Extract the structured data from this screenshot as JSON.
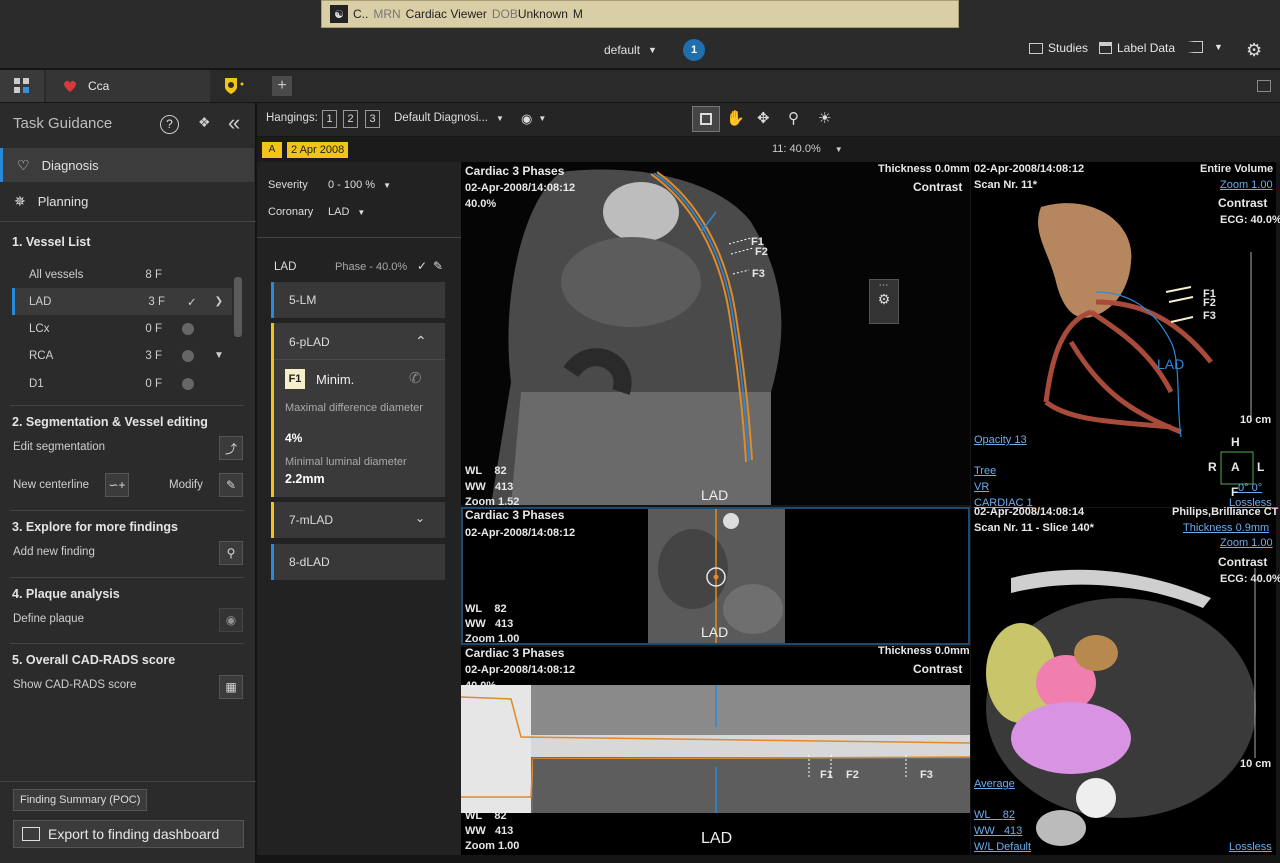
{
  "patient_bar": {
    "name": "C..",
    "mrn_label": "MRN",
    "app": "Cardiac Viewer",
    "dob_label": "DOB",
    "dob": "Unknown",
    "sex": "M"
  },
  "header": {
    "layout": "default",
    "count": "1",
    "studies": "Studies",
    "label_data": "Label Data"
  },
  "tabs": {
    "cca": "Cca"
  },
  "task": {
    "title": "Task Guidance",
    "nav": {
      "diagnosis": "Diagnosis",
      "planning": "Planning"
    },
    "vessel_list": {
      "heading": "1. Vessel List",
      "rows": [
        {
          "name": "All vessels",
          "count": "8 F"
        },
        {
          "name": "LAD",
          "count": "3 F"
        },
        {
          "name": "LCx",
          "count": "0 F"
        },
        {
          "name": "RCA",
          "count": "3 F"
        },
        {
          "name": "D1",
          "count": "0 F"
        }
      ]
    },
    "seg": {
      "heading": "2. Segmentation & Vessel editing",
      "edit": "Edit segmentation",
      "new_centerline": "New centerline",
      "modify": "Modify"
    },
    "explore": {
      "heading": "3. Explore for more findings",
      "add": "Add new finding"
    },
    "plaque": {
      "heading": "4. Plaque analysis",
      "define": "Define plaque"
    },
    "cadrads": {
      "heading": "5. Overall CAD-RADS score",
      "show": "Show CAD-RADS score"
    },
    "finding_summary": "Finding Summary (POC)",
    "export": "Export to finding dashboard"
  },
  "toolbar": {
    "hangings_label": "Hangings:",
    "hangings": [
      "1",
      "2",
      "3"
    ],
    "protocol": "Default Diagnosi..."
  },
  "study": {
    "date": "2 Apr 2008",
    "zoom_info": "11: 40.0%"
  },
  "filters": {
    "severity_label": "Severity",
    "severity": "0 - 100 %",
    "coronary_label": "Coronary",
    "coronary": "LAD"
  },
  "vessel_panel": {
    "vessel": "LAD",
    "phase": "Phase - 40.0%",
    "segments": [
      "5-LM",
      "6-pLAD",
      "7-mLAD",
      "8-dLAD"
    ],
    "finding": {
      "badge": "F1",
      "name": "Minim.",
      "m1_label": "Maximal difference diameter",
      "m1_value": "4%",
      "m2_label": "Minimal luminal diameter",
      "m2_value": "2.2mm"
    }
  },
  "viewports": {
    "cpr": {
      "title": "Cardiac 3 Phases",
      "date": "02-Apr-2008/14:08:12",
      "phase": "40.0%",
      "thickness": "Thickness 0.0mm",
      "contrast": "Contrast",
      "wl": "WL",
      "wl_v": "82",
      "ww": "WW",
      "ww_v": "413",
      "zoom": "Zoom 1.52",
      "vessel": "LAD",
      "labels": [
        "F1",
        "F2",
        "F3"
      ]
    },
    "cross": {
      "title": "Cardiac 3 Phases",
      "date": "02-Apr-2008/14:08:12",
      "wl": "WL",
      "wl_v": "82",
      "ww": "WW",
      "ww_v": "413",
      "zoom": "Zoom 1.00",
      "vessel": "LAD"
    },
    "stretched": {
      "title": "Cardiac 3 Phases",
      "date": "02-Apr-2008/14:08:12",
      "phase": "40.0%",
      "thickness": "Thickness 0.0mm",
      "contrast": "Contrast",
      "wl": "WL",
      "wl_v": "82",
      "ww": "WW",
      "ww_v": "413",
      "zoom": "Zoom 1.00",
      "vessel": "LAD",
      "labels": [
        "F1",
        "F2",
        "F3"
      ]
    },
    "vr": {
      "date": "02-Apr-2008/14:08:12",
      "scan": "Scan Nr. 11*",
      "volume": "Entire Volume",
      "zoom": "Zoom 1.00",
      "contrast": "Contrast",
      "ecg": "ECG: 40.0%",
      "opacity": "Opacity 13",
      "tree": "Tree",
      "vr": "VR",
      "preset": "CARDIAC 1",
      "lossless": "Lossless",
      "scale": "10 cm",
      "vessel": "LAD",
      "labels": [
        "F1",
        "F2",
        "F3"
      ],
      "orient": {
        "h": "H",
        "r": "R",
        "a": "A",
        "l": "L",
        "f": "F"
      },
      "angle": "0° 0°"
    },
    "axial": {
      "date": "02-Apr-2008/14:08:14",
      "scan": "Scan Nr. 11 - Slice 140*",
      "scanner": "Philips,Brilliance CT",
      "thickness": "Thickness 0.9mm",
      "zoom": "Zoom 1.00",
      "contrast": "Contrast",
      "ecg": "ECG: 40.0%",
      "average": "Average",
      "wl": "WL",
      "wl_v": "82",
      "ww": "WW",
      "ww_v": "413",
      "wl_default": "W/L Default",
      "lossless": "Lossless",
      "scale": "10 cm"
    }
  },
  "colors": {
    "accent": "#2a8ad8",
    "highlight": "#f0c419",
    "centerline": "#e08a2a"
  }
}
